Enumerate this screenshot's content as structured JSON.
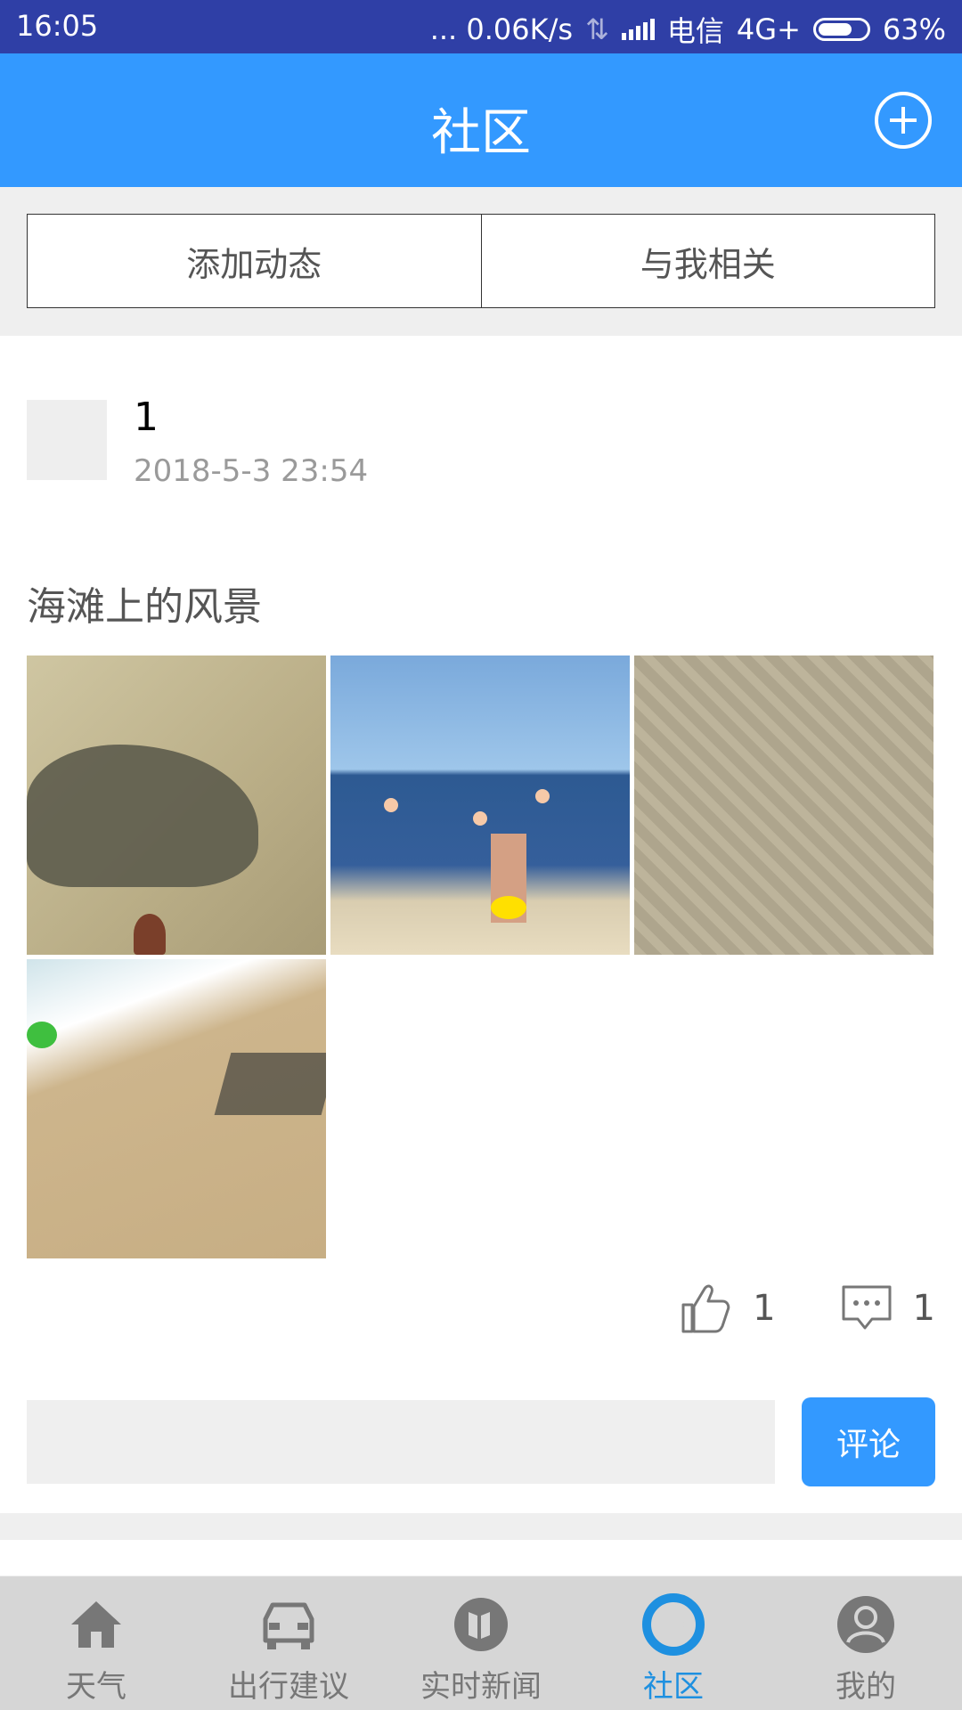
{
  "status_bar": {
    "time": "16:05",
    "network_speed": "... 0.06K/s",
    "carrier": "电信",
    "network_type": "4G+",
    "battery": "63%",
    "battery_level": 0.63
  },
  "header": {
    "title": "社区",
    "add_icon": "plus-circle-icon"
  },
  "segments": [
    {
      "label": "添加动态"
    },
    {
      "label": "与我相关"
    }
  ],
  "post": {
    "username": "1",
    "timestamp": "2018-5-3 23:54",
    "text": "海滩上的风景",
    "likes": "1",
    "comments": "1",
    "comment_input_placeholder": "",
    "comment_button": "评论"
  },
  "bottom_nav": [
    {
      "label": "天气",
      "icon": "house-icon"
    },
    {
      "label": "出行建议",
      "icon": "car-icon"
    },
    {
      "label": "实时新闻",
      "icon": "news-icon"
    },
    {
      "label": "社区",
      "icon": "community-icon",
      "active": true
    },
    {
      "label": "我的",
      "icon": "user-icon"
    }
  ],
  "colors": {
    "status_bar": "#2f3fa6",
    "app_bar": "#3399ff",
    "active_tab": "#1e90e0"
  }
}
